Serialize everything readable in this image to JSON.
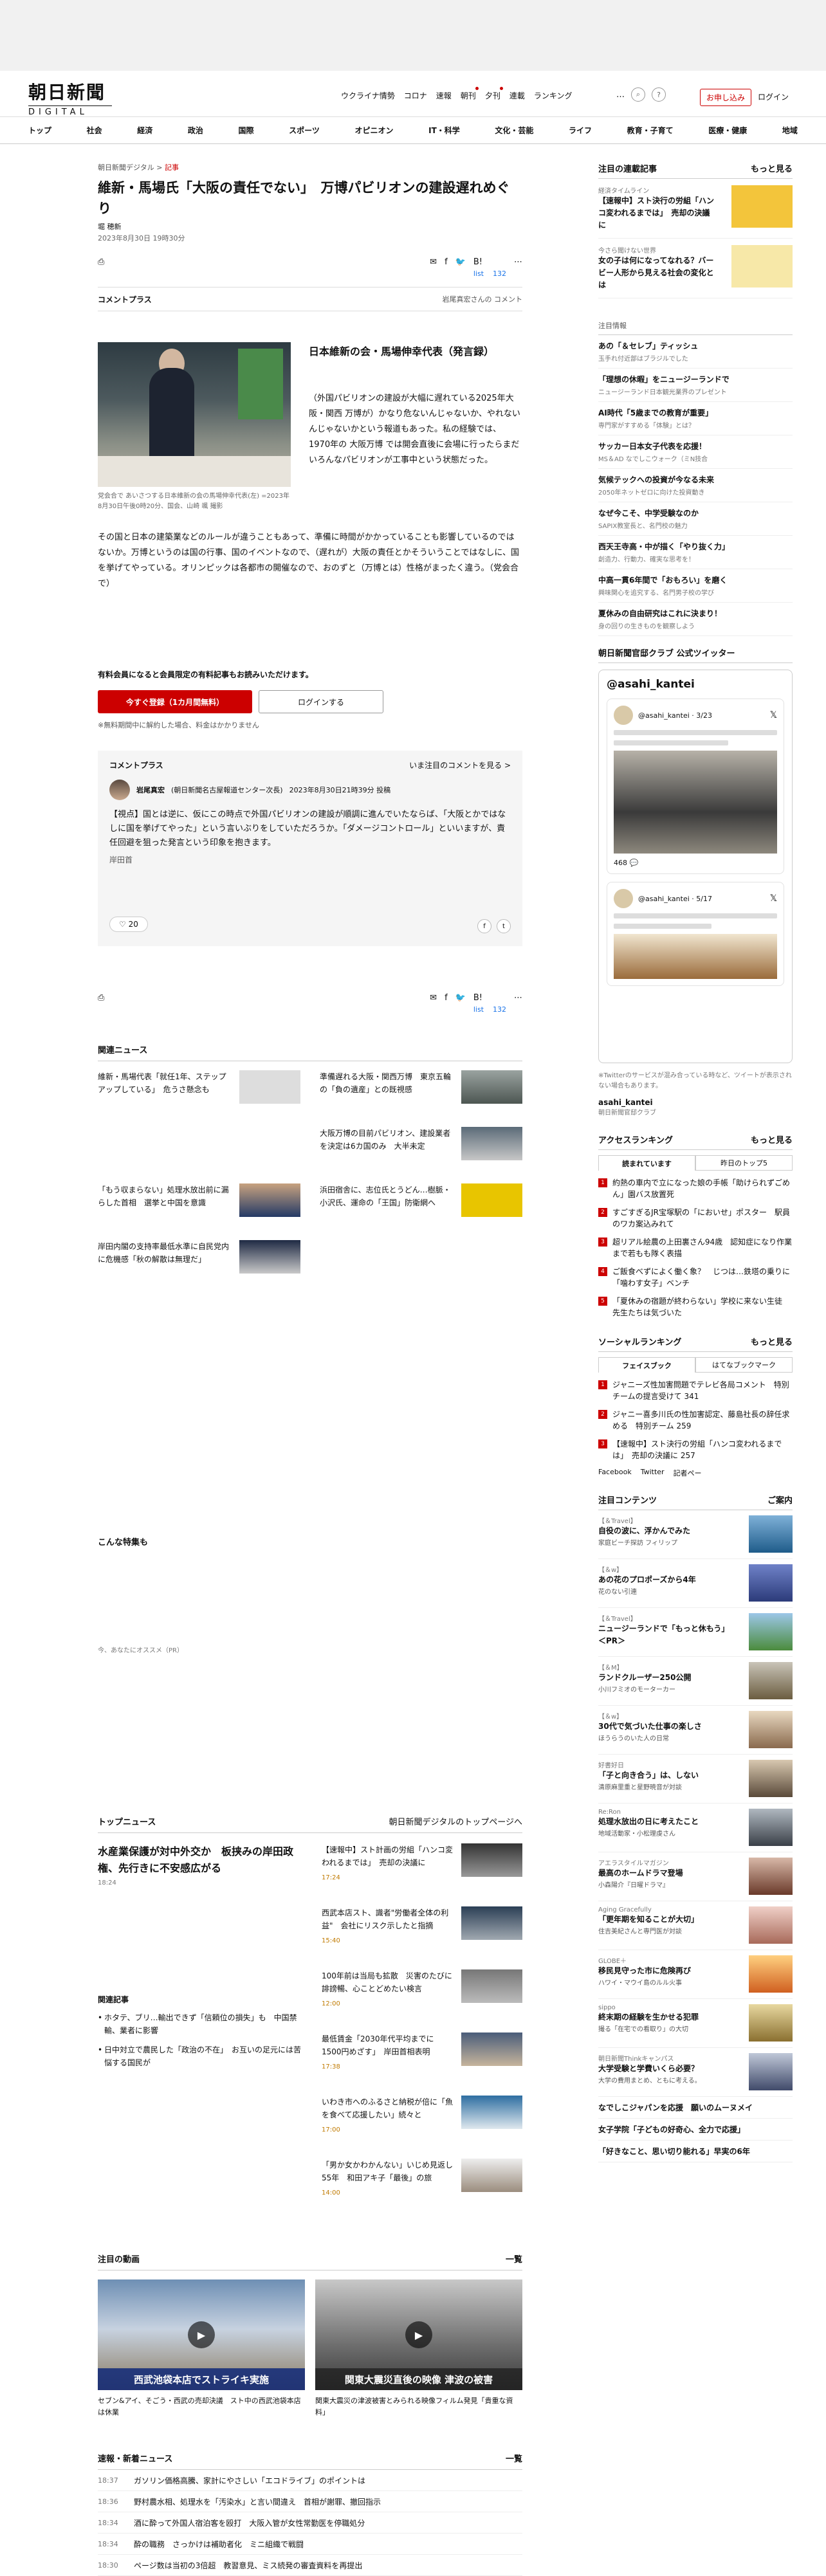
{
  "header": {
    "logo_jp": "朝日新聞",
    "logo_en": "DIGITAL",
    "nav": [
      "ウクライナ情勢",
      "コロナ",
      "速報",
      "朝刊",
      "夕刊",
      "連載",
      "ランキング"
    ],
    "more": "…",
    "search_icon": "⌕",
    "help": "?",
    "subscribe": "お申し込み",
    "login": "ログイン"
  },
  "categories": [
    "トップ",
    "社会",
    "経済",
    "政治",
    "国際",
    "スポーツ",
    "オピニオン",
    "IT・科学",
    "文化・芸能",
    "ライフ",
    "教育・子育て",
    "医療・健康",
    "地域"
  ],
  "article": {
    "crumb_site": "朝日新聞デジタル",
    "crumb_sep": ">",
    "crumb_type": "記事",
    "title": "維新・馬場氏「大阪の責任でない」　万博パビリオンの建設遅れめぐり",
    "author": "堀 穂新",
    "date": "2023年8月30日 19時30分",
    "share_marks": [
      "✉",
      "f",
      "🐦",
      "B!",
      "⋯"
    ],
    "bk_labels": [
      "list",
      "132"
    ],
    "comment_plus": "コメントプラス",
    "comment_note": "岩尾真宏さんの コメント",
    "photo_caption": "党会合で あいさつする日本維新の会の馬場伸幸代表(左) =2023年8月30日午後0時20分、国会、山崎 颯 撮影",
    "lead_title": "日本維新の会・馬場伸幸代表（発言録）",
    "p1": "（外国パビリオンの建設が大幅に遅れている2025年大阪・関西 万博が）かなり危ないんじゃないか、やれないんじゃないかという報道もあった。私の経験では、1970年の 大阪万博 では開会直後に会場に行ったらまだいろんなパビリオンが工事中という状態だった。",
    "p2": "その国と日本の建築業などのルールが違うこともあって、準備に時間がかかっていることも影響しているのではないか。万博というのは国の行事、国のイベントなので、（遅れが）大阪の責任とかそういうことではなしに、国を挙げてやっている。オリンピックは各都市の開催なので、おのずと（万博とは）性格がまったく違う。（党会合で）",
    "member_q": "有料会員になると会員限定の有料記事もお読みいただけます。",
    "register": "今すぐ登録（1カ月間無料）",
    "login2": "ログインする",
    "free_note": "※無料期間中に解約した場合、料金はかかりません"
  },
  "comment": {
    "header": "コメントプラス",
    "see": "いま注目のコメントを見る >",
    "name": "岩尾真宏",
    "org": "(朝日新聞名古屋報道センター次長)",
    "time": "2023年8月30日21時39分 投稿",
    "text": "【視点】国とは逆に、仮にこの時点で外国パビリオンの建設が順調に進んでいたならば、「大阪とかではなしに国を挙げてやった」という言いぶりをしていただろうか。「ダメージコントロール」といいますが、責任回避を狙った発言という印象を抱きます。",
    "sig": "岸田首",
    "likes": "♡ 20"
  },
  "related": {
    "title": "関連ニュース",
    "items": [
      {
        "t": "維新・馬場代表「就任1年、ステップアップしている」　危うさ懸念も"
      },
      {
        "t": "準備遅れる大阪・関西万博　東京五輪の「負の遺産」との既視感"
      },
      {
        "t": ""
      },
      {
        "t": "大阪万博の目前パビリオン、建設業者を決定は6カ国のみ　大半未定"
      },
      {
        "t": "「もう収まらない」処理水放出前に漏らした首相　選挙と中国を意識"
      },
      {
        "t": "浜田宿舎に、志位氏とうどん…樹脈・小沢氏、運命の「王国」防衛網へ"
      },
      {
        "t": "岸田内閣の支持率最低水準に自民党内に危機感「秋の解散は無理だ」"
      }
    ]
  },
  "konna": "こんな特集も",
  "osusume": "今、あなたにオススメ（PR）",
  "topnews": {
    "title": "トップニュース",
    "more": "朝日新聞デジタルのトップページへ",
    "lead": "水産業保護が対中外交か　板挟みの岸田政権、先行きに不安感広がる",
    "lead_time": "18:24",
    "rel_title": "関連記事",
    "rel": [
      "ホタテ、ブリ…輸出できず「信頼位の損失」も　中国禁輸、業者に影響",
      "日中対立で農民した「政治の不在」　お互いの足元には苦悩する国民が"
    ],
    "items": [
      {
        "t": "【速報中】スト計画の労組「ハンコ変われるまでは」　売却の決議に",
        "tm": "17:24"
      },
      {
        "t": "西武本店スト、識者\"労働者全体の利益\"　会社にリスク示したと指摘",
        "tm": "15:40"
      },
      {
        "t": "100年前は当局も拡散　災害のたびに誹謗暢、心ことどめたい検言",
        "tm": "12:00"
      },
      {
        "t": "最低賃金「2030年代平均までに1500円めざす」　岸田首相表明",
        "tm": "17:38"
      },
      {
        "t": "いわき市へのふるさと納税が倍に「魚を食べて応援したい」続々と",
        "tm": "17:00"
      },
      {
        "t": "「男か女かわかんない」いじめ見返し55年　和田アキ子「最後」の旅",
        "tm": "14:00"
      }
    ]
  },
  "videos": {
    "title": "注目の動画",
    "more": "一覧",
    "items": [
      {
        "label": "西武池袋本店でストライキ実施",
        "cap": "セブン&アイ、そごう・西武の売却決議　スト中の西武池袋本店は休業"
      },
      {
        "label": "関東大震災直後の映像 津波の被害",
        "cap": "関東大震災の津波被害とみられる映像フィルム発見「貴重な資料」"
      }
    ]
  },
  "quick": {
    "title": "速報・新着ニュース",
    "more": "一覧",
    "items": [
      {
        "tm": "18:37",
        "t": "ガソリン価格高騰、家計にやさしい「エコドライブ」のポイントは"
      },
      {
        "tm": "18:36",
        "t": "野村農水相、処理水を「汚染水」と言い間違え　首相が謝罪、撤回指示"
      },
      {
        "tm": "18:34",
        "t": "酒に酔って外国人宿泊客を殴打　大阪入管が女性常勤医を停職処分"
      },
      {
        "tm": "18:34",
        "t": "酔の職務　さっかけは補助者化　ミニ組織で戦闘"
      },
      {
        "tm": "18:30",
        "t": "ページ数は当初の3倍超　教習意見、ミス続発の審査資料を再提出"
      }
    ]
  },
  "side": {
    "serial_title": "注目の連載記事",
    "serial_more": "もっと見る",
    "serials": [
      {
        "k": "経済タイムライン",
        "t": "【速報中】スト決行の労組「ハンコ変われるまでは」　売却の決議に"
      },
      {
        "k": "今さら聞けない世界",
        "t": "女の子は何になってなれる？バービー人形から見える社会の変化とは"
      }
    ],
    "chumoku_label": "注目情報",
    "chumoku": [
      {
        "t": "あの「＆セレブ」ティッシュ",
        "s": "玉手れ付近部はブラジルでした"
      },
      {
        "t": "「理想の休暇」をニュージーランドで",
        "s": "ニュージーランド日本観光業界のプレゼント"
      },
      {
        "t": "AI時代「5歳までの教育が重要」",
        "s": "専門家がすすめる「体験」とは？"
      },
      {
        "t": "サッカー日本女子代表を応援！",
        "s": "MS＆AD なでしこウォーク（ミN技合"
      },
      {
        "t": "気候テックへの投資が今なる未来",
        "s": "2050年ネットゼロに向けた投資動き"
      },
      {
        "t": "なぜ今こそ、中学受験なのか",
        "s": "SAPIX教室長と、名門校の魅力"
      },
      {
        "t": "西天王寺高・中が描く「やり抜く力」",
        "s": "創造力、行動力、確実な思考を！"
      },
      {
        "t": "中高一貫6年間で「おもろい」を磨く",
        "s": "興味関心を追究する、名門男子校の学び"
      },
      {
        "t": "夏休みの自由研究はこれに決まり！",
        "s": "身の回りの生きものを観察しよう"
      }
    ],
    "tw_title": "朝日新聞官邸クラブ 公式ツイッター",
    "tw_handle": "@asahi_kantei",
    "tw_u1": "@asahi_kantei · 3/23",
    "tw_u2": "@asahi_kantei · 5/17",
    "tw_count": "468 💬",
    "tw_foot": "※Twitterのサービスが混み合っている時など、ツイートが表示されない場合もあります。",
    "tw_acct": "asahi_kantei",
    "tw_acct2": "朝日新聞官邸クラブ",
    "access_title": "アクセスランキング",
    "access_more": "もっと見る",
    "tabs": [
      "読まれています",
      "昨日のトップ5"
    ],
    "access": [
      "約熱の車内で立になった娘の手帳「助けられずごめん」園バス放置死",
      "すごすぎるJR宝塚駅の「においせ」ポスター　駅員のワカ案込みれて",
      "超リアル絵農の上田裏さん94歳　認知症になり作業まで若もも隊く表描",
      "ご飯食べずによく働く象？　じつは…鉄塔の乗りに「噛わす女子」ベンチ",
      "「夏休みの宿題が終わらない」学校に来ない生徒　先生たちは気づいた"
    ],
    "social_title": "ソーシャルランキング",
    "social_more": "もっと見る",
    "social_tabs": [
      "フェイスブック",
      "はてなブックマーク"
    ],
    "social": [
      "ジャニーズ性加害問題でテレビ各局コメント　特別チームの提言受けて 341",
      "ジャニー喜多川氏の性加害認定、藤島社長の辞任求める　特別チーム 259",
      "【速報中】スト決行の労組「ハンコ変われるまでは」　売却の決議に 257"
    ],
    "social_foot": [
      "Facebook",
      "Twitter",
      "記者ペー"
    ],
    "contents_title": "注目コンテンツ",
    "contents_more": "ご案内",
    "contents": [
      {
        "k": "【＆Travel】",
        "t": "自役の波に、浮かんでみた",
        "s": "家庭ビーチ探訪 フィリップ"
      },
      {
        "k": "【＆w】",
        "t": "あの花のプロポーズから4年",
        "s": "花のない引連"
      },
      {
        "k": "【＆Travel】",
        "t": "ニュージーランドで「もっと休もう」＜PR＞",
        "s": ""
      },
      {
        "k": "【＆M】",
        "t": "ランドクルーザー250公開",
        "s": "小川フミオのモーターカー"
      },
      {
        "k": "【＆w】",
        "t": "30代で気づいた仕事の楽しさ",
        "s": "ほうらうのいた人の日常"
      },
      {
        "k": "好書好日",
        "t": "「子と向き合う」は、しない",
        "s": "清原麻里重と星野暁音が対談"
      },
      {
        "k": "Re:Ron",
        "t": "処理水放出の日に考えたこと",
        "s": "地域活動家・小松理虔さん"
      },
      {
        "k": "アエラスタイルマガジン",
        "t": "最高のホームドラマ登場",
        "s": "小森陽介『日曜ドラマ』"
      },
      {
        "k": "Aging Gracefully",
        "t": "「更年期を知ることが大切」",
        "s": "住吉美紀さんと専門医が対談"
      },
      {
        "k": "GLOBE＋",
        "t": "移民見守った市に危険再び",
        "s": "ハワイ・マウイ島のルル火事"
      },
      {
        "k": "sippo",
        "t": "終末期の経験を生かせる犯罪",
        "s": "撮る「在宅での看取り」の大切"
      },
      {
        "k": "朝日新聞Thinkキャンパス",
        "t": "大学受験と学費いくら必要？",
        "s": "大学の費用まとめ、ともに考える。"
      }
    ],
    "bottom1": "なでしこジャパンを応援　願いのムーヌメイ",
    "bottom2": "女子学院「子どもの好奇心、全力で応援」",
    "bottom3": "「好きなこと、思い切り能れる」早実の6年"
  },
  "colors": {
    "accent": "#cc0000"
  }
}
